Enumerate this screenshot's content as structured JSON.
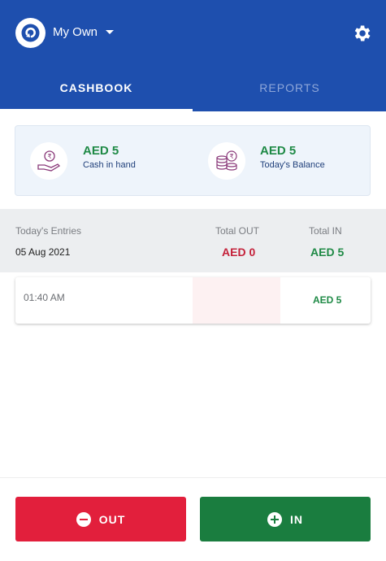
{
  "header": {
    "business_name": "My Own",
    "tabs": [
      {
        "label": "CASHBOOK",
        "active": true
      },
      {
        "label": "REPORTS",
        "active": false
      }
    ]
  },
  "summary": {
    "cash_in_hand": {
      "value": "AED 5",
      "label": "Cash in hand"
    },
    "todays_balance": {
      "value": "AED 5",
      "label": "Today's Balance"
    }
  },
  "entries": {
    "col_entries": "Today's Entries",
    "col_out": "Total OUT",
    "col_in": "Total IN",
    "date": "05 Aug 2021",
    "total_out": "AED 0",
    "total_in": "AED 5",
    "rows": [
      {
        "time": "01:40 AM",
        "out": "",
        "in": "AED 5"
      }
    ]
  },
  "actions": {
    "out_label": "OUT",
    "in_label": "IN"
  },
  "colors": {
    "header": "#1e4fae",
    "green": "#1f8a46",
    "red": "#e21f3c"
  }
}
